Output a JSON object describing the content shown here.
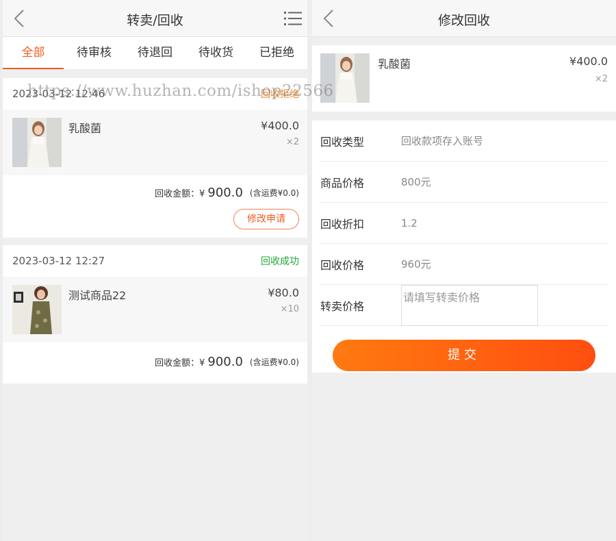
{
  "left": {
    "header": {
      "title": "转卖/回收"
    },
    "tabs": [
      "全部",
      "待审核",
      "待退回",
      "待收货",
      "已拒绝"
    ],
    "orders": [
      {
        "time": "2023-03-12 12:46",
        "status": "回收拒绝",
        "product": {
          "name": "乳酸菌",
          "price": "¥400.0",
          "qty": "×2"
        },
        "amount_label": "回收金额：¥",
        "amount": "900.0",
        "fee": "(含运费¥0.0)",
        "action": "修改申请"
      },
      {
        "time": "2023-03-12 12:27",
        "status": "回收成功",
        "product": {
          "name": "测试商品22",
          "price": "¥80.0",
          "qty": "×10"
        },
        "amount_label": "回收金额：¥",
        "amount": "900.0",
        "fee": "(含运费¥0.0)"
      }
    ]
  },
  "watermark": "https://www.huzhan.com/ishop22566",
  "right": {
    "header": {
      "title": "修改回收"
    },
    "product": {
      "name": "乳酸菌",
      "price": "¥400.0",
      "qty": "×2"
    },
    "form": {
      "recycle_type": {
        "label": "回收类型",
        "value": "回收款项存入账号"
      },
      "goods_price": {
        "label": "商品价格",
        "value": "800元"
      },
      "discount": {
        "label": "回收折扣",
        "value": "1.2"
      },
      "recycle_price": {
        "label": "回收价格",
        "value": "960元"
      },
      "resale_price": {
        "label": "转卖价格",
        "placeholder": "请填写转卖价格"
      }
    },
    "submit": "提交"
  },
  "colors": {
    "accent": "#f25c1e",
    "success": "#21a63b",
    "warning": "#f0882a",
    "button_start": "#ff7a10",
    "button_end": "#ff4e10"
  },
  "icons": [
    "back-arrow-icon",
    "menu-list-icon"
  ]
}
